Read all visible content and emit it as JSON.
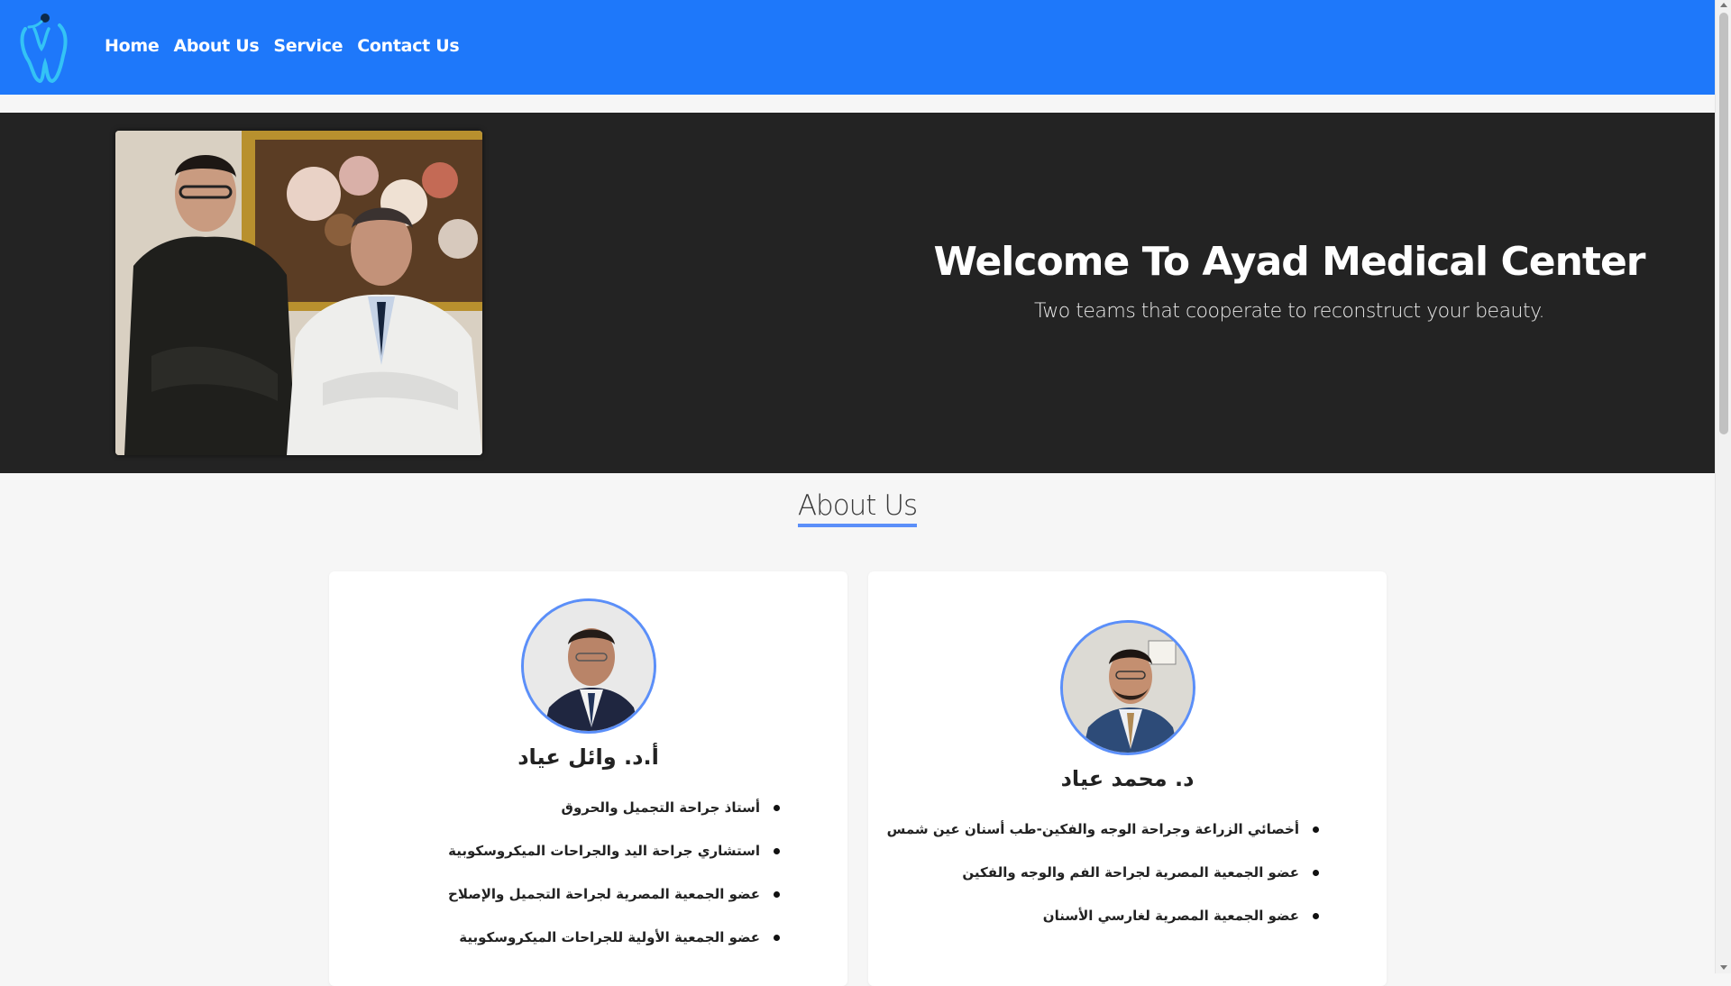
{
  "navbar": {
    "logo_icon": "tooth-icon",
    "links": [
      {
        "label": "Home"
      },
      {
        "label": "About Us"
      },
      {
        "label": "Service"
      },
      {
        "label": "Contact Us"
      }
    ],
    "background_color": "#1e78fa"
  },
  "hero": {
    "title": "Welcome To Ayad Medical Center",
    "subtitle": "Two teams that cooperate to reconstruct your beauty.",
    "background_color": "#232323"
  },
  "about": {
    "heading": "About Us",
    "accent_color": "#5b8ff9",
    "doctors": [
      {
        "name": "أ.د. وائل عياد",
        "items": [
          "أستاذ جراحة التجميل والحروق",
          "استشاري جراحة اليد والجراحات الميكروسكوبية",
          "عضو الجمعية المصرية لجراحة التجميل والإصلاح",
          "عضو الجمعية الأولية للجراحات الميكروسكوبية"
        ]
      },
      {
        "name": "د. محمد عياد",
        "items": [
          "أخصائي الزراعة وجراحة الوجه والفكين-طب أسنان عين شمس",
          "عضو الجمعية المصرية لجراحة الفم والوجه والفكين",
          "عضو الجمعية المصرية لغارسي الأسنان"
        ]
      }
    ]
  }
}
